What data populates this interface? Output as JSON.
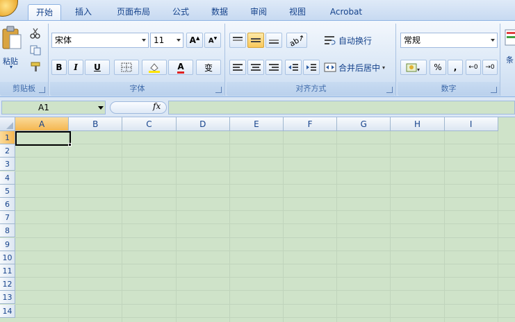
{
  "tabs": [
    {
      "label": "开始",
      "active": true
    },
    {
      "label": "插入"
    },
    {
      "label": "页面布局"
    },
    {
      "label": "公式"
    },
    {
      "label": "数据"
    },
    {
      "label": "审阅"
    },
    {
      "label": "视图"
    },
    {
      "label": "Acrobat"
    }
  ],
  "clipboard": {
    "paste_label": "粘贴",
    "group_label": "剪贴板"
  },
  "font": {
    "name": "宋体",
    "size": "11",
    "group_label": "字体",
    "wen_glyph": "变",
    "bold": "B",
    "italic": "I",
    "underline": "U",
    "font_color_glyph": "A"
  },
  "alignment": {
    "wrap_label": "自动换行",
    "merge_label": "合并后居中",
    "group_label": "对齐方式"
  },
  "number": {
    "format": "常规",
    "percent": "%",
    "comma": ",",
    "group_label": "数字",
    "next_label": "条"
  },
  "formula_bar": {
    "name_box": "A1",
    "fx": "fx"
  },
  "grid": {
    "columns": [
      "A",
      "B",
      "C",
      "D",
      "E",
      "F",
      "G",
      "H",
      "I"
    ],
    "rows": [
      "1",
      "2",
      "3",
      "4",
      "5",
      "6",
      "7",
      "8",
      "9",
      "10",
      "11",
      "12",
      "13",
      "14"
    ],
    "selected_cell": "A1"
  },
  "colors": {
    "sheet_bg": "#cfe3c9",
    "ribbon_accent": "#15428b",
    "selected_header": "#f4b650"
  }
}
